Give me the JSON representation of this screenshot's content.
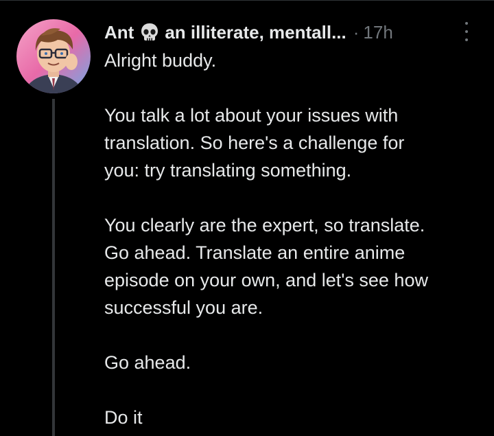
{
  "tweet": {
    "author_name": "Ant",
    "emoji_icon": "skull-emoji",
    "handle": "an illiterate, mentall...",
    "separator": "·",
    "time": "17h",
    "more_icon": "more-options-icon",
    "paragraphs": [
      "Alright buddy.",
      "You talk a lot about your issues with\ntranslation. So here's a challenge for\nyou: try translating something.",
      "You clearly are the expert, so translate.\nGo ahead. Translate an entire anime\nepisode on your own, and let's see how\nsuccessful you are.",
      "Go ahead.",
      "Do it"
    ]
  },
  "colors": {
    "background": "#000000",
    "text": "#e7e9ea",
    "secondary_text": "#71767b",
    "thread_line": "#333639"
  }
}
